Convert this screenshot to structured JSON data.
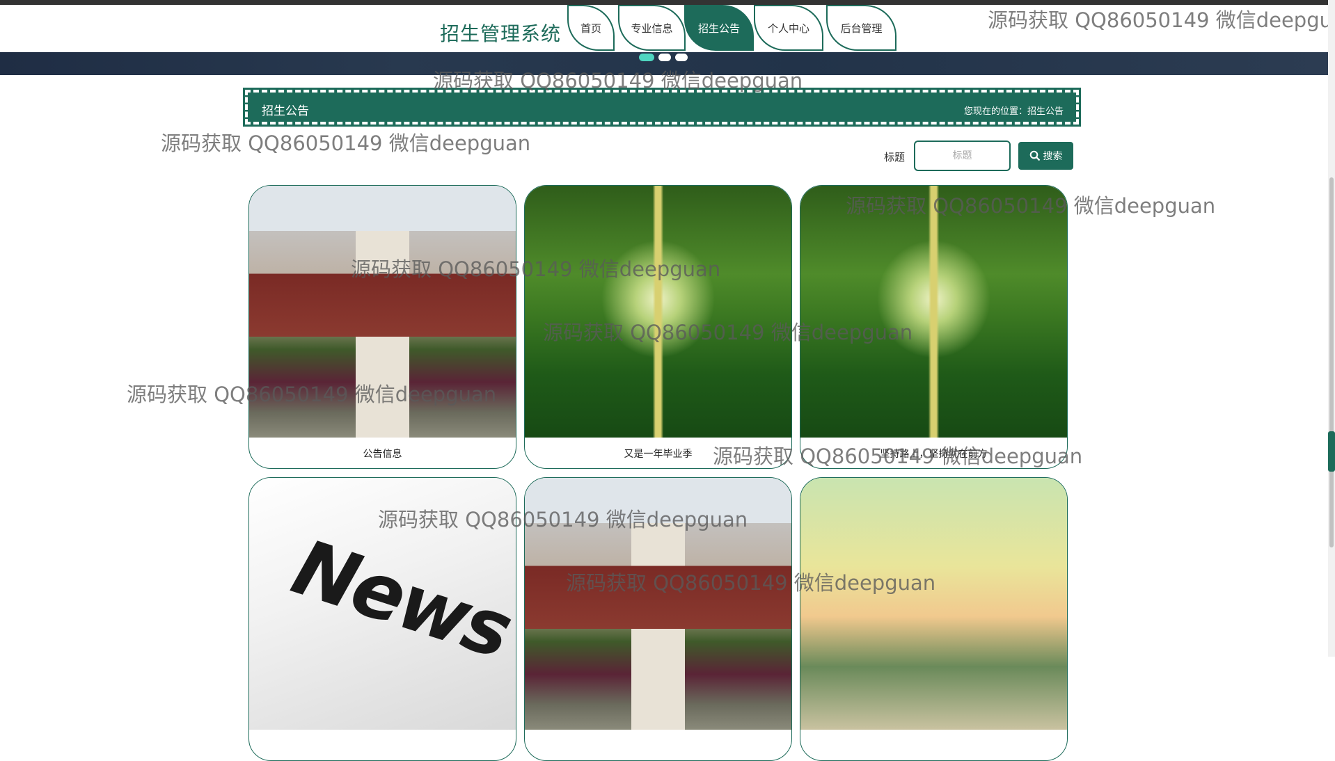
{
  "header": {
    "site_title": "招生管理系统",
    "nav": [
      {
        "label": "首页",
        "active": false
      },
      {
        "label": "专业信息",
        "active": false
      },
      {
        "label": "招生公告",
        "active": true
      },
      {
        "label": "个人中心",
        "active": false
      },
      {
        "label": "后台管理",
        "active": false
      }
    ]
  },
  "carousel": {
    "slide_count": 3,
    "active_index": 0
  },
  "section": {
    "title": "招生公告",
    "breadcrumb": "您现在的位置：招生公告"
  },
  "search": {
    "label": "标题",
    "placeholder": "标题",
    "button_label": "搜索"
  },
  "cards": [
    {
      "caption": "公告信息",
      "image": "school-building"
    },
    {
      "caption": "又是一年毕业季",
      "image": "tree-lined-road"
    },
    {
      "caption": "坚持路上，坚持就在前方",
      "image": "tree-lined-road"
    },
    {
      "caption": "",
      "image": "news-newspaper",
      "image_text": "News"
    },
    {
      "caption": "",
      "image": "school-building"
    },
    {
      "caption": "",
      "image": "campus-sunset"
    }
  ],
  "watermark": "源码获取 QQ86050149 微信deepguan",
  "colors": {
    "primary": "#1d6b5a",
    "active_dot": "#4fd6c0",
    "banner": "#223349"
  }
}
